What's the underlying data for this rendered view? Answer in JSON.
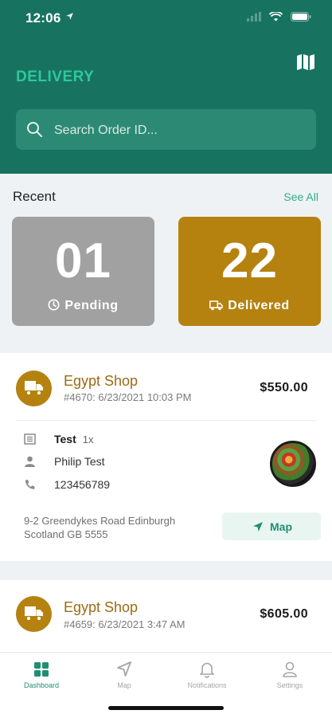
{
  "status_bar": {
    "time": "12:06"
  },
  "header": {
    "title": "DELIVERY",
    "map_icon": "map-icon",
    "search": {
      "placeholder": "Search Order ID...",
      "value": ""
    }
  },
  "recent": {
    "title": "Recent",
    "see_all": "See All",
    "pending": {
      "count": "01",
      "label": "Pending"
    },
    "delivered": {
      "count": "22",
      "label": "Delivered"
    }
  },
  "orders": [
    {
      "shop": "Egypt Shop",
      "meta": "#4670: 6/23/2021 10:03 PM",
      "price": "$550.00",
      "item": "Test",
      "qty": "1x",
      "customer": "Philip Test",
      "phone": "123456789",
      "address": "9-2 Greendykes Road Edinburgh Scotland GB 5555",
      "map_label": "Map"
    },
    {
      "shop": "Egypt Shop",
      "meta": "#4659: 6/23/2021 3:47 AM",
      "price": "$605.00"
    }
  ],
  "tabs": [
    {
      "label": "Dashboard",
      "icon": "dashboard-icon"
    },
    {
      "label": "Map",
      "icon": "navigation-icon"
    },
    {
      "label": "Notifications",
      "icon": "bell-icon"
    },
    {
      "label": "Settings",
      "icon": "user-icon"
    }
  ],
  "colors": {
    "header_green": "#17735f",
    "accent_green": "#2fc79b",
    "gold": "#b58210",
    "gray": "#a1a1a1"
  }
}
